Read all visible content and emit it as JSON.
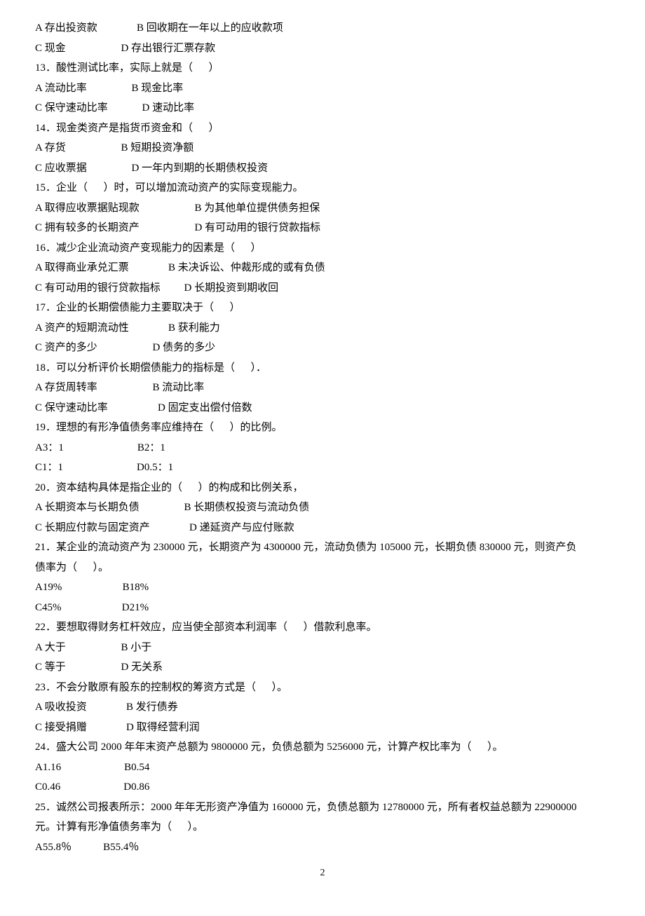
{
  "lines": [
    "A 存出投资款               B 回收期在一年以上的应收款项",
    "C 现金                     D 存出银行汇票存款",
    "13．酸性测试比率，实际上就是（      ）",
    "A 流动比率                 B 现金比率",
    "C 保守速动比率             D 速动比率",
    "14．现金类资产是指货币资金和（      ）",
    "A 存货                     B 短期投资净额",
    "C 应收票据                 D 一年内到期的长期债权投资",
    "15．企业（      ）时，可以增加流动资产的实际变现能力。",
    "A 取得应收票据贴现款                     B 为其他单位提供债务担保",
    "C 拥有较多的长期资产                     D 有可动用的银行贷款指标",
    "16．减少企业流动资产变现能力的因素是（      ）",
    "A 取得商业承兑汇票               B 未决诉讼、仲裁形成的或有负债",
    "C 有可动用的银行贷款指标         D 长期投资到期收回",
    "17．企业的长期偿债能力主要取决于（      ）",
    "A 资产的短期流动性               B 获利能力",
    "C 资产的多少                     D 债务的多少",
    "18．可以分析评价长期偿债能力的指标是（      ）．",
    "A 存货周转率                     B 流动比率",
    "C 保守速动比率                   D 固定支出偿付倍数",
    "19．理想的有形净值债务率应维持在（      ）的比例。",
    "A3：1                            B2：1",
    "C1：1                            D0.5：1",
    "20．资本结构具体是指企业的（      ）的构成和比例关系，",
    "A 长期资本与长期负债                 B 长期债权投资与流动负债",
    "C 长期应付款与固定资产               D 递延资产与应付账款",
    "21．某企业的流动资产为 230000 元，长期资产为 4300000 元，流动负债为 105000 元，长期负债 830000 元，则资产负",
    "债率为（      ）。",
    "A19%                       B18%",
    "C45%                       D21%",
    "22．要想取得财务杠杆效应，应当使全部资本利润率（      ）借款利息率。",
    "A 大于                     B 小于",
    "C 等于                     D 无关系",
    "23．不会分散原有股东的控制权的筹资方式是（      ）。",
    "A 吸收投资               B 发行债券",
    "C 接受捐赠               D 取得经营利润",
    "24．盛大公司 2000 年年末资产总额为 9800000 元，负债总额为 5256000 元，计算产权比率为（      ）。",
    "A1.16                        B0.54",
    "C0.46                        D0.86",
    "25．诚然公司报表所示：2000 年年无形资产净值为 160000 元，负债总额为 12780000 元，所有者权益总额为 22900000",
    "元。计算有形净值债务率为（      ）。",
    "A55.8％            B55.4％"
  ],
  "page_number": "2"
}
